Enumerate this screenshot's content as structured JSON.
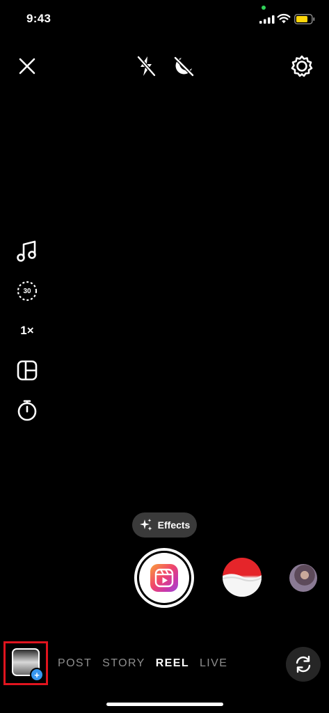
{
  "status": {
    "time": "9:43"
  },
  "tools": {
    "timer_label": "30",
    "speed_label": "1×"
  },
  "effects": {
    "label": "Effects"
  },
  "modes": [
    {
      "label": "POST",
      "active": false
    },
    {
      "label": "STORY",
      "active": false
    },
    {
      "label": "REEL",
      "active": true
    },
    {
      "label": "LIVE",
      "active": false
    }
  ],
  "colors": {
    "highlight": "#e0141e",
    "gallery_badge": "#3897f0",
    "effects_pill": "#3a3a3a"
  }
}
